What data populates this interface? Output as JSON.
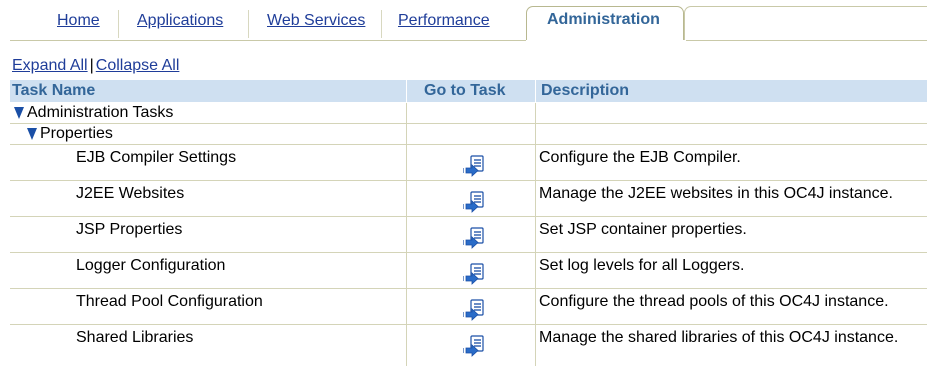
{
  "tabs": {
    "home": "Home",
    "applications": "Applications",
    "web_services": "Web Services",
    "performance": "Performance",
    "administration": "Administration"
  },
  "controls": {
    "expand_all": "Expand All",
    "separator": "|",
    "collapse_all": "Collapse All"
  },
  "table": {
    "headers": {
      "task_name": "Task Name",
      "go_to_task": "Go to Task",
      "description": "Description"
    },
    "tree": {
      "root": "Administration Tasks",
      "group": "Properties"
    },
    "rows": [
      {
        "name": "EJB Compiler Settings",
        "description": "Configure the EJB Compiler."
      },
      {
        "name": "J2EE Websites",
        "description": "Manage the J2EE websites in this OC4J instance."
      },
      {
        "name": "JSP Properties",
        "description": "Set JSP container properties."
      },
      {
        "name": "Logger Configuration",
        "description": "Set log levels for all Loggers."
      },
      {
        "name": "Thread Pool Configuration",
        "description": "Configure the thread pools of this OC4J instance."
      },
      {
        "name": "Shared Libraries",
        "description": "Manage the shared libraries of this OC4J instance."
      }
    ]
  },
  "icons": {
    "expanded": "expanded-triangle-icon",
    "go_to_task": "go-to-task-icon"
  },
  "colors": {
    "link": "#1f3d99",
    "header_bg": "#cfe0f1",
    "header_text": "#336699",
    "active_tab_text": "#336699"
  }
}
